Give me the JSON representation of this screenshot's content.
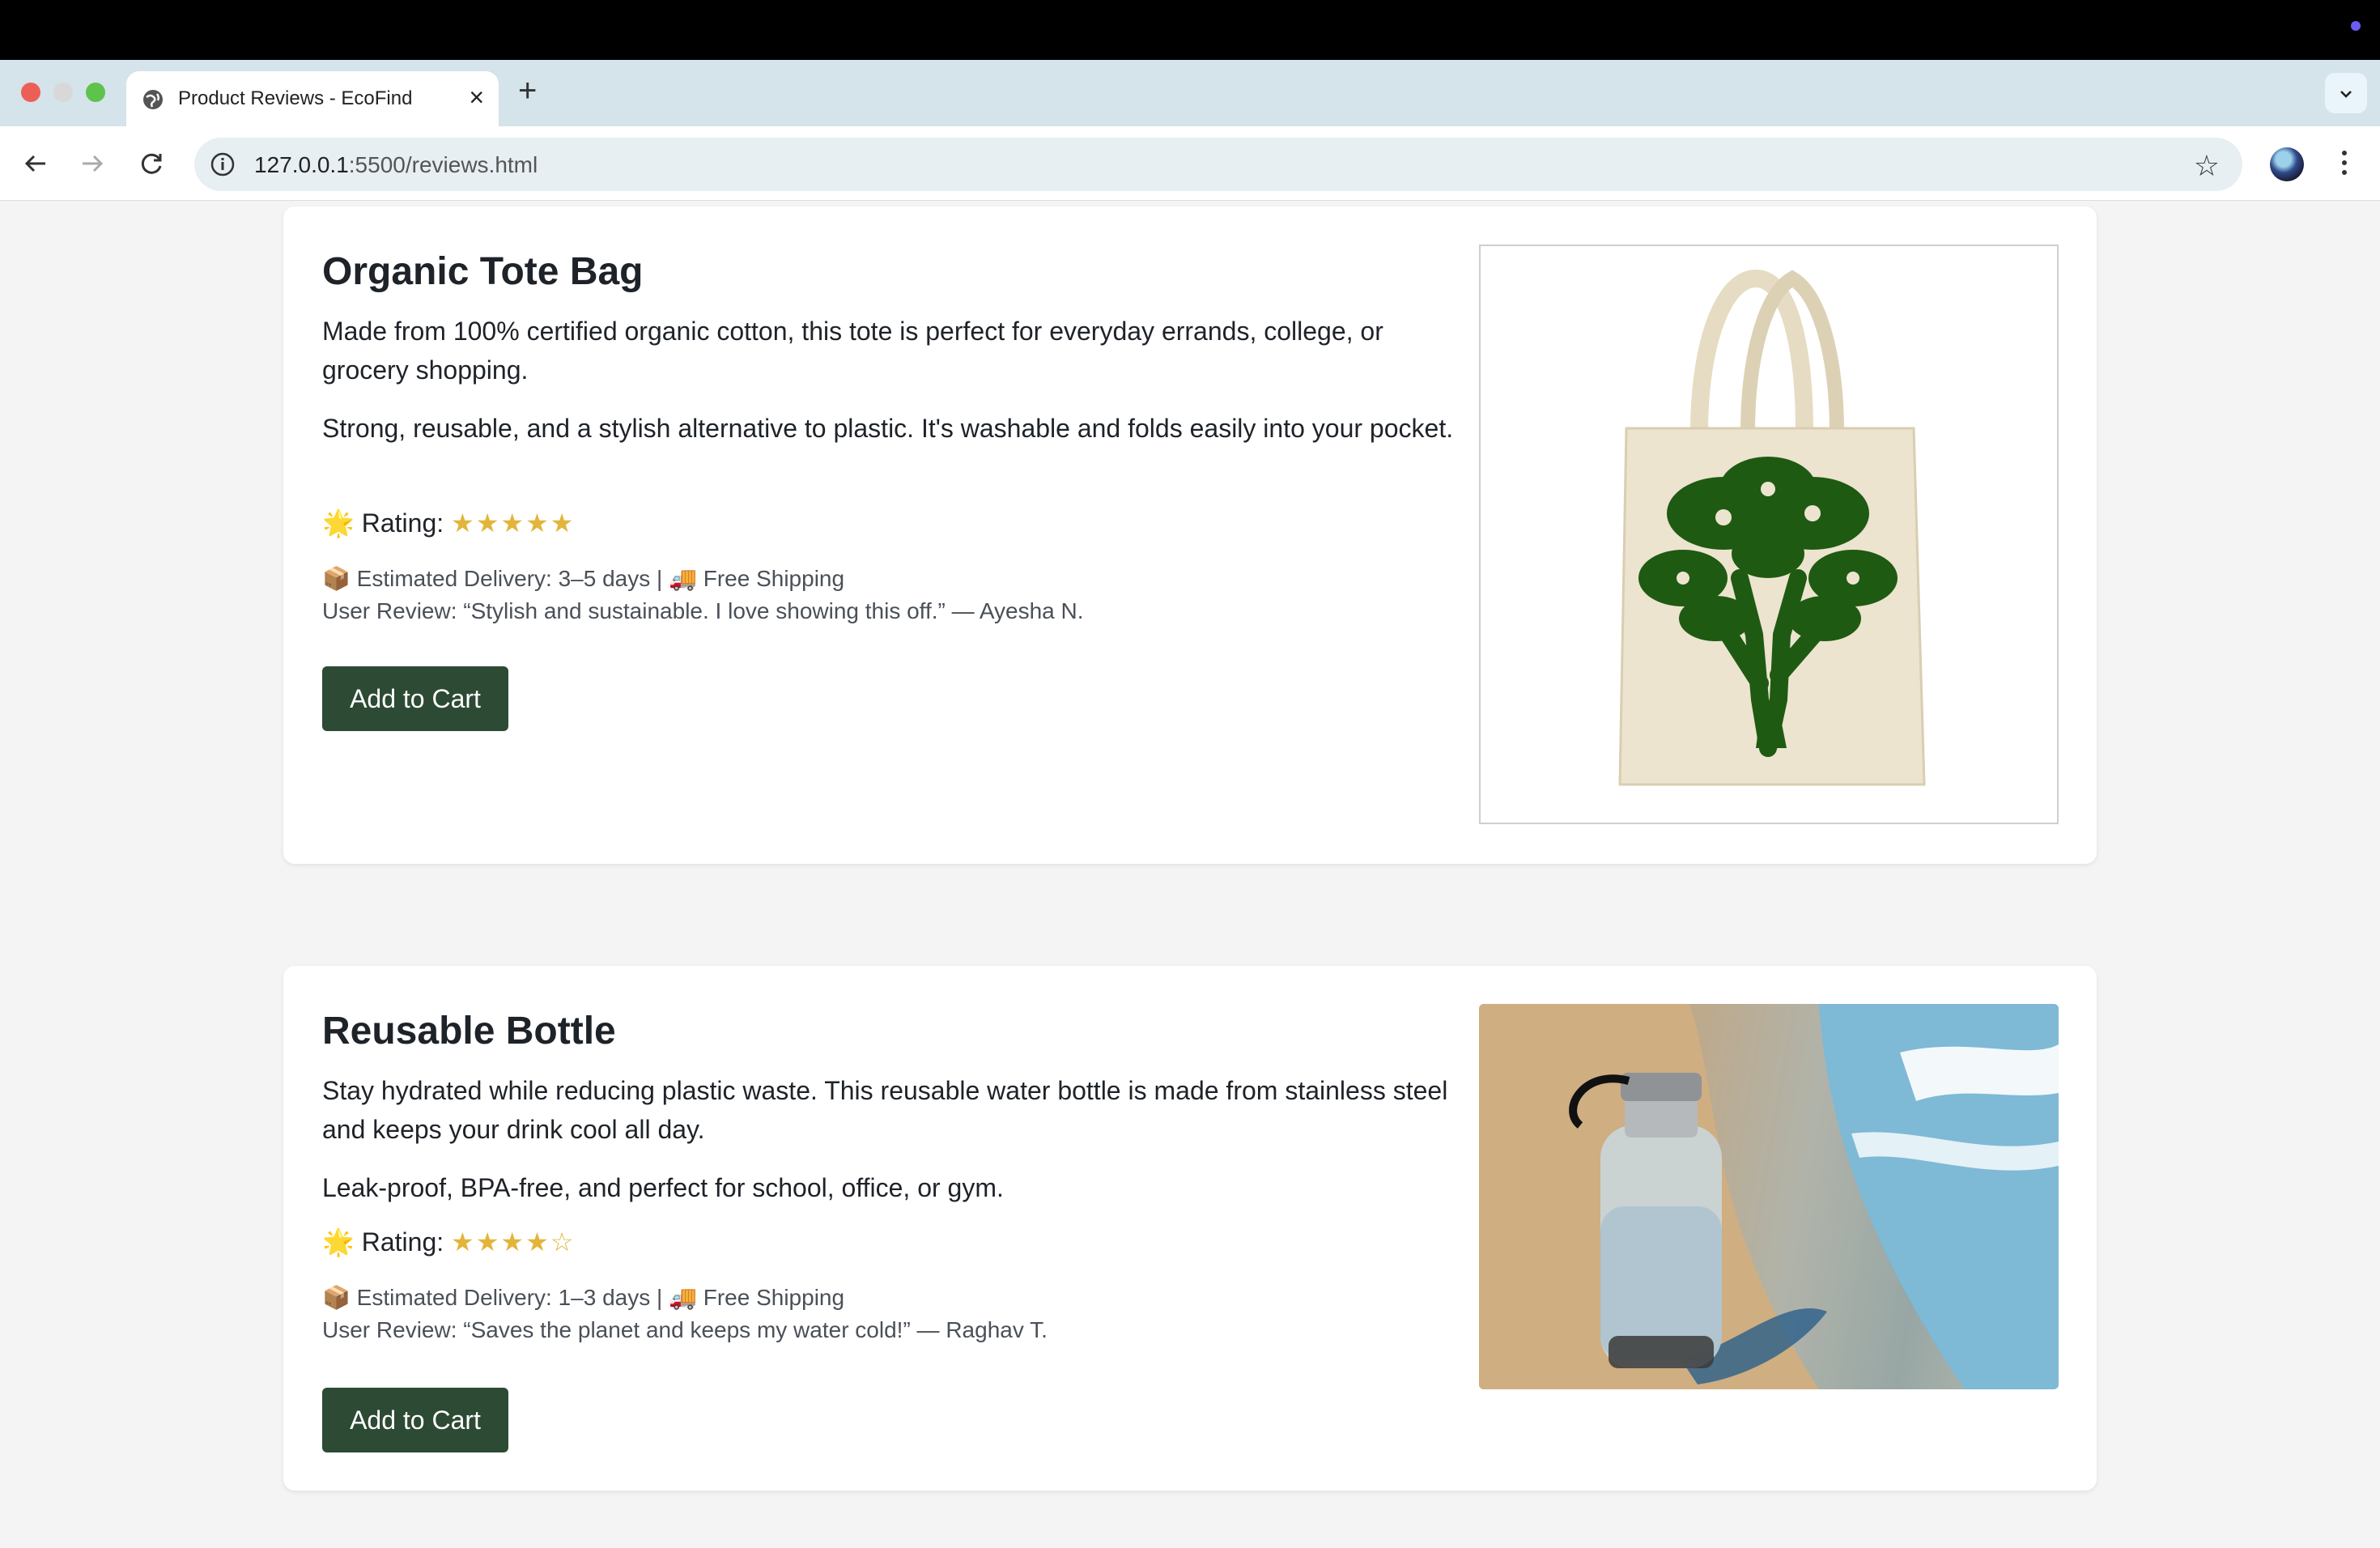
{
  "browser": {
    "tab_title": "Product Reviews - EcoFind",
    "url_host": "127.0.0.1",
    "url_rest": ":5500/reviews.html"
  },
  "products": [
    {
      "name": "Organic Tote Bag",
      "desc1": "Made from 100% certified organic cotton, this tote is perfect for everyday errands, college, or grocery shopping.",
      "desc2": "Strong, reusable, and a stylish alternative to plastic. It's washable and folds easily into your pocket.",
      "rating_prefix": "🌟 Rating:",
      "rating_stars": "★★★★★",
      "rating_value": 5,
      "delivery": "📦 Estimated Delivery: 3–5 days | 🚚 Free Shipping",
      "review": "User Review: “Stylish and sustainable. I love showing this off.” — Ayesha N.",
      "button": "Add to Cart"
    },
    {
      "name": "Reusable Bottle",
      "desc1": "Stay hydrated while reducing plastic waste. This reusable water bottle is made from stainless steel and keeps your drink cool all day.",
      "desc2": "Leak-proof, BPA-free, and perfect for school, office, or gym.",
      "rating_prefix": "🌟 Rating:",
      "rating_stars": "★★★★☆",
      "rating_value": 4,
      "delivery": "📦 Estimated Delivery: 1–3 days | 🚚 Free Shipping",
      "review": "User Review: “Saves the planet and keeps my water cold!” — Raghav T.",
      "button": "Add to Cart"
    }
  ],
  "colors": {
    "button_bg": "#2d4a34",
    "star": "#e2b53a",
    "tote_print": "#1f5a12"
  }
}
